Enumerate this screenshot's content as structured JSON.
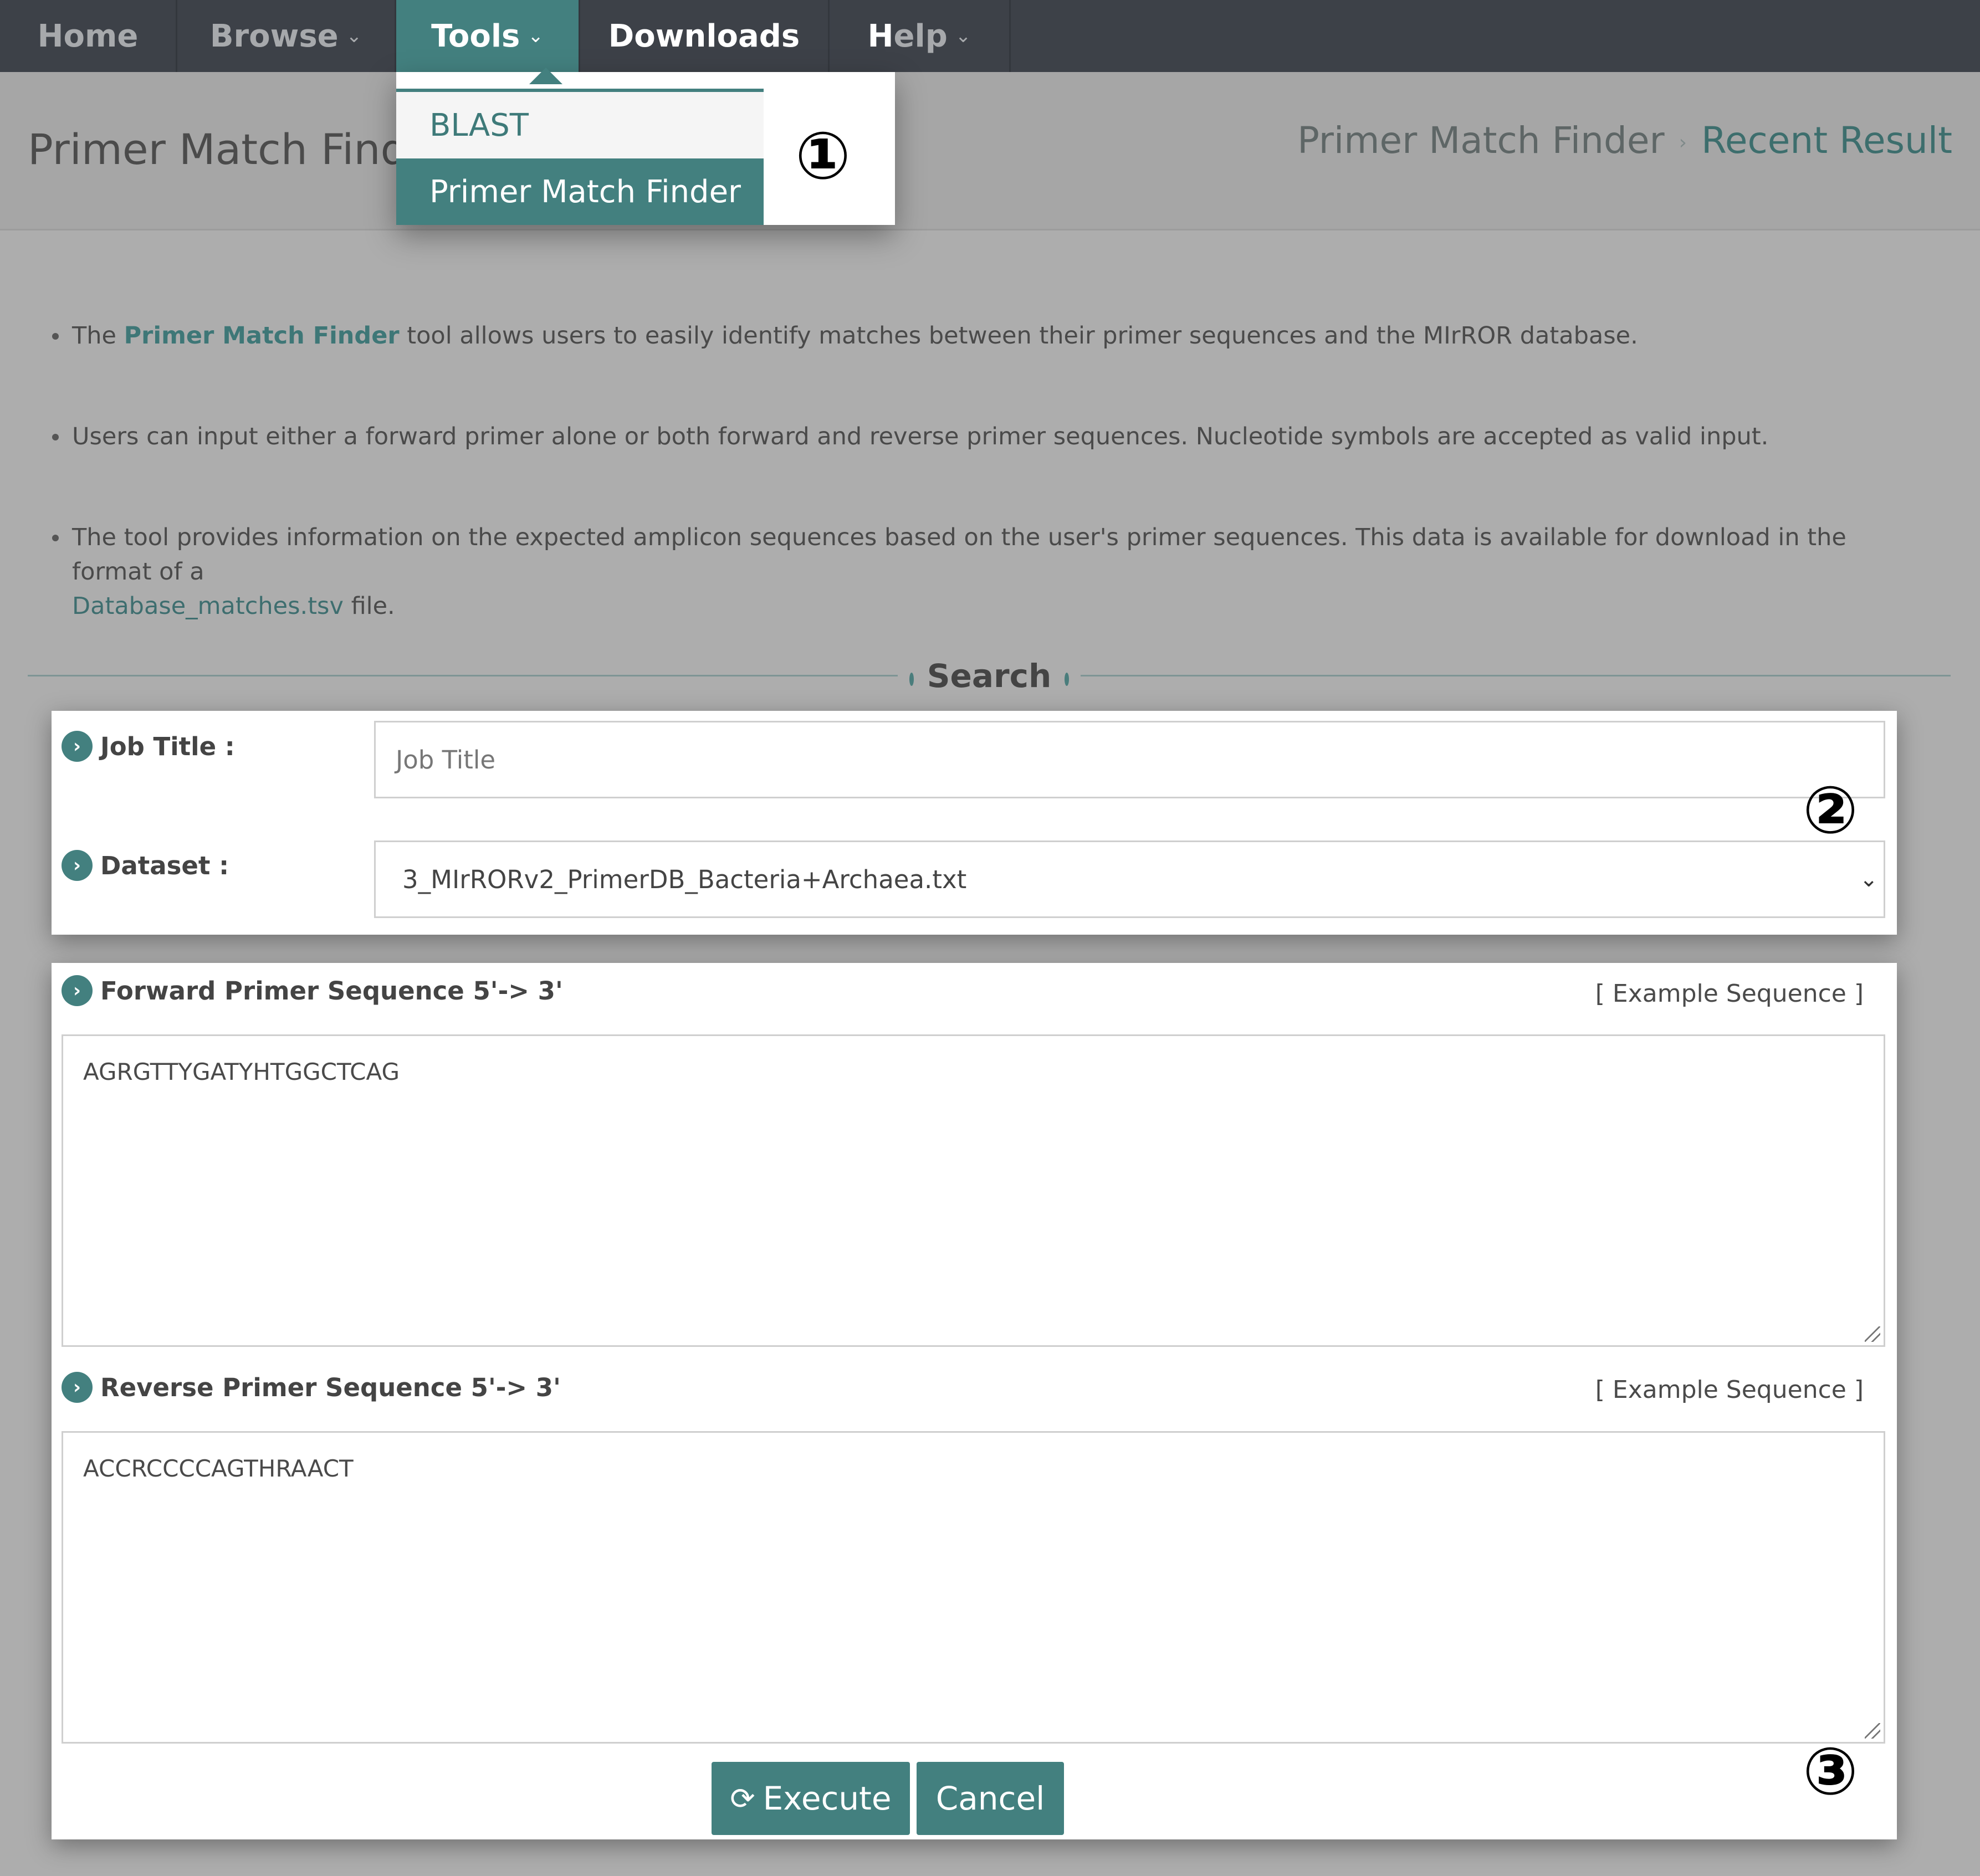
{
  "nav": {
    "home": "Home",
    "browse": "Browse",
    "tools": "Tools",
    "downloads": "Downloads",
    "help_h": "H",
    "help_rest": "elp",
    "chevron": "⌄"
  },
  "dropdown": {
    "items": [
      "BLAST",
      "Primer Match Finder"
    ],
    "active": "Primer Match Finder"
  },
  "header": {
    "title": "Primer Match Finde",
    "breadcrumb": [
      "Primer Match Finder",
      "Recent Result"
    ],
    "separator": "›"
  },
  "markers": [
    "①",
    "②",
    "③"
  ],
  "intro": {
    "b1_pre": "The ",
    "b1_hl": "Primer Match Finder",
    "b1_post": " tool allows users to easily identify matches between their primer sequences and the MIrROR database.",
    "b2": "Users can input either a forward primer alone or both forward and reverse primer sequences. Nucleotide symbols are accepted as valid input.",
    "b3_pre": "The tool provides information on the expected amplicon sequences based on the user's primer sequences. This data is available for download in the format of a",
    "b3_link": "Database_matches.tsv",
    "b3_post": " file."
  },
  "search": {
    "section_label": "Search"
  },
  "form": {
    "job_title_label": "Job Title :",
    "job_title_placeholder": "Job Title",
    "dataset_label": "Dataset :",
    "dataset_value": "3_MIrRORv2_PrimerDB_Bacteria+Archaea.txt",
    "forward_label": "Forward Primer Sequence 5'-> 3'",
    "forward_example": "[ Example Sequence ]",
    "forward_value": "AGRGTTYGATYHTGGCTCAG",
    "reverse_label": "Reverse Primer Sequence 5'-> 3'",
    "reverse_example": "[ Example Sequence ]",
    "reverse_value": "ACCRCCCCAGTHRAACT",
    "execute_label": "Execute",
    "cancel_label": "Cancel"
  },
  "colors": {
    "accent": "#43807f",
    "nav_bg": "#3d4148",
    "overlay_bg": "#adadad"
  }
}
